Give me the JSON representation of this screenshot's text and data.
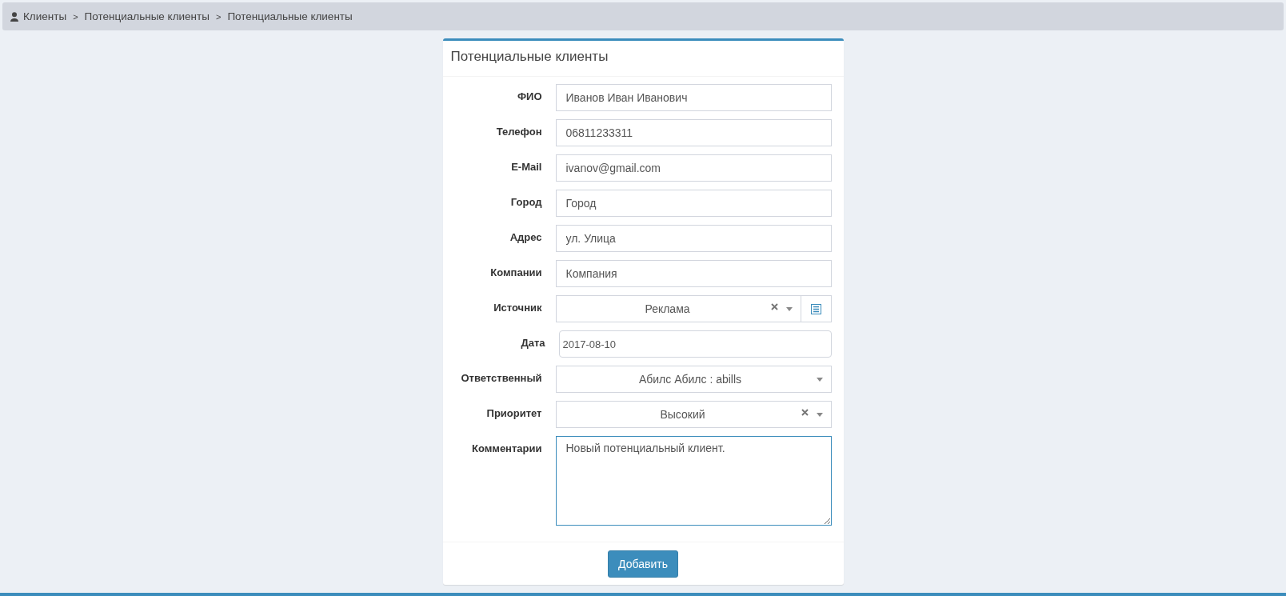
{
  "breadcrumb": [
    "Клиенты",
    "Потенциальные клиенты",
    "Потенциальные клиенты"
  ],
  "breadcrumb_separator": ">",
  "card": {
    "title": "Потенциальные клиенты",
    "fields": [
      {
        "label": "ФИО",
        "kind": "text",
        "value": "Иванов Иван Иванович"
      },
      {
        "label": "Телефон",
        "kind": "text",
        "value": "06811233311"
      },
      {
        "label": "E-Mail",
        "kind": "text",
        "value": "ivanov@gmail.com"
      },
      {
        "label": "Город",
        "kind": "text",
        "value": "Город"
      },
      {
        "label": "Адрес",
        "kind": "text",
        "value": "ул. Улица"
      },
      {
        "label": "Компании",
        "kind": "text",
        "value": "Компания"
      },
      {
        "label": "Источник",
        "kind": "select",
        "value": "Реклама",
        "clearable": true,
        "addon": true
      },
      {
        "label": "Дата",
        "kind": "date",
        "value": "2017-08-10"
      },
      {
        "label": "Ответственный",
        "kind": "select",
        "value": "Абилс Абилс : abills",
        "clearable": false,
        "addon": false
      },
      {
        "label": "Приоритет",
        "kind": "select",
        "value": "Высокий",
        "clearable": true,
        "addon": false
      },
      {
        "label": "Комментарии",
        "kind": "textarea",
        "value": "Новый потенциальный клиент.",
        "focused": true
      }
    ],
    "submit": "Добавить"
  }
}
